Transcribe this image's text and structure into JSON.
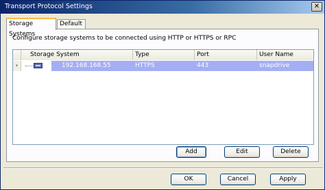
{
  "window": {
    "title": "Transport Protocol Settings",
    "close_glyph": "✕"
  },
  "tabs": [
    {
      "label": "Storage Systems",
      "active": true
    },
    {
      "label": "Default",
      "active": false
    }
  ],
  "description": "Configure storage systems to be connected using  HTTP or HTTPS or RPC",
  "grid": {
    "columns": [
      "Storage System",
      "Type",
      "Port",
      "User Name"
    ],
    "rows": [
      {
        "expander": "›",
        "storage_system": "192.168.168.55",
        "type": "HTTPS",
        "port": "443",
        "user_name": "snapdrive",
        "selected": true
      }
    ]
  },
  "buttons": {
    "add": "Add",
    "edit": "Edit",
    "delete": "Delete",
    "ok": "OK",
    "cancel": "Cancel",
    "apply": "Apply"
  },
  "colors": {
    "selection": "#a4aef2",
    "titlebar": "#0a246a",
    "accent_tab": "#f9b84a"
  }
}
